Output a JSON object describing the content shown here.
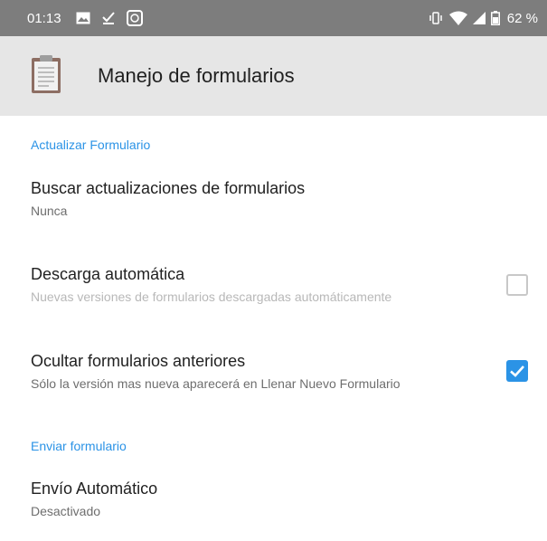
{
  "status_bar": {
    "time": "01:13",
    "battery": "62 %",
    "left_icons": [
      "image-icon",
      "download-done-icon",
      "app-icon"
    ],
    "right_icons": [
      "vibrate-icon",
      "wifi-icon",
      "signal-icon",
      "battery-icon"
    ]
  },
  "toolbar": {
    "icon": "clipboard-icon",
    "title": "Manejo de formularios"
  },
  "sections": [
    {
      "header": "Actualizar Formulario",
      "items": [
        {
          "title": "Buscar actualizaciones de formularios",
          "summary": "Nunca"
        },
        {
          "title": "Descarga automática",
          "summary": "Nuevas versiones de formularios descargadas automáticamente",
          "checked": false,
          "enabled": false
        },
        {
          "title": "Ocultar formularios anteriores",
          "summary": "Sólo la versión mas nueva aparecerá en Llenar Nuevo Formulario",
          "checked": true,
          "enabled": true
        }
      ]
    },
    {
      "header": "Enviar formulario",
      "items": [
        {
          "title": "Envío Automático",
          "summary": "Desactivado"
        }
      ]
    }
  ],
  "colors": {
    "accent": "#2b93e6",
    "status_bar": "#7d7d7d",
    "toolbar": "#e6e6e6"
  }
}
